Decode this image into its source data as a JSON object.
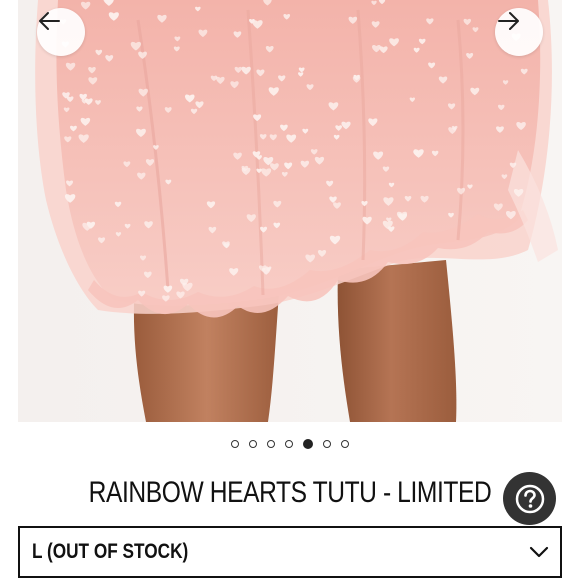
{
  "product": {
    "title": "RAINBOW HEARTS TUTU - LIMITED",
    "image_alt": "Model wearing a pink tulle tutu skirt with white heart print",
    "gallery": {
      "total": 7,
      "active_index": 4
    }
  },
  "size_select": {
    "selected_label": "L (OUT OF STOCK)"
  },
  "icons": {
    "prev": "arrow-left-icon",
    "next": "arrow-right-icon",
    "help": "help-question-icon",
    "dropdown": "chevron-down-icon"
  },
  "colors": {
    "tulle_pink": "#f6c2bb",
    "heart_white": "#fdf2ef",
    "skin": "#b27552",
    "help_button_bg": "#333333",
    "text": "#111111"
  }
}
